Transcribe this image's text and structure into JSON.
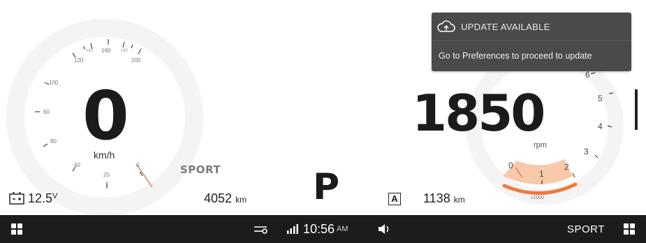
{
  "speedometer": {
    "speed": "0",
    "unit": "km/h",
    "scale_labels": [
      "120",
      "140",
      "160",
      "180",
      "200",
      "100",
      "60",
      "80",
      "40",
      "20",
      "0"
    ],
    "tick_1": "1"
  },
  "tachometer": {
    "rpm": "1850",
    "unit": "rpm",
    "scale_labels": [
      "0",
      "1",
      "2",
      "3",
      "4",
      "5",
      "6"
    ],
    "multiplier": "x1000"
  },
  "drive_mode": "SPORT",
  "gear": "P",
  "battery": {
    "voltage": "12.5",
    "unit": "V",
    "icon": "battery-icon"
  },
  "odometer": {
    "value": "4052",
    "unit": "km"
  },
  "trip": {
    "value": "1138",
    "unit": "km",
    "badge": "A"
  },
  "notification": {
    "title": "UPDATE AVAILABLE",
    "message": "Go to Preferences to proceed to update",
    "icon": "cloud-update-icon"
  },
  "status_bar": {
    "time": "10:56",
    "ampm": "AM",
    "mode": "SPORT",
    "left_icon": "apps-grid-icon",
    "right_icon": "apps-grid-icon",
    "connection_icon": "key-connection-icon",
    "signal_icon": "signal-bars-icon",
    "volume_icon": "speaker-icon"
  },
  "colors": {
    "accent": "#f07a3c",
    "accent_fill": "#f7c9a8",
    "bar_bg": "#1c1c1c",
    "toast_bg": "#4a4a4a"
  }
}
